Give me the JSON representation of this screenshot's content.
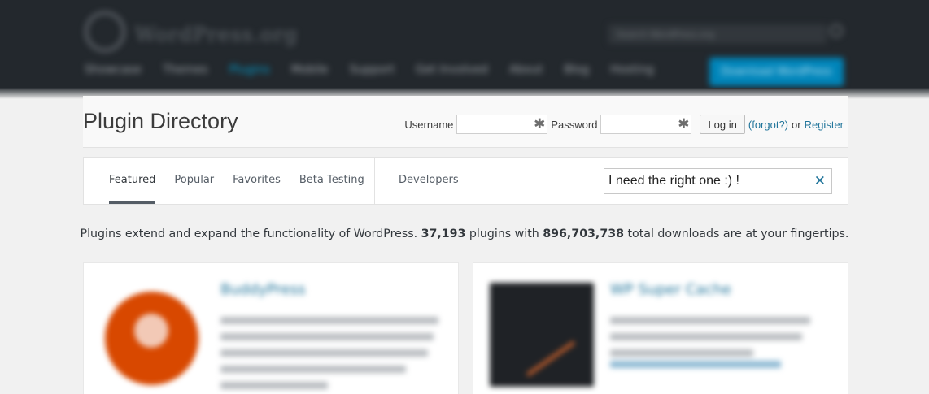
{
  "header": {
    "title": "Plugin Directory",
    "username_label": "Username",
    "password_label": "Password",
    "login_button": "Log in",
    "forgot_link": "(forgot?)",
    "or_text": "or",
    "register_link": "Register"
  },
  "tabs": [
    {
      "label": "Featured",
      "active": true
    },
    {
      "label": "Popular",
      "active": false
    },
    {
      "label": "Favorites",
      "active": false
    },
    {
      "label": "Beta Testing",
      "active": false
    }
  ],
  "developers_tab": "Developers",
  "search": {
    "value": "I need the right one :) !",
    "clear_icon": "close-icon"
  },
  "intro": {
    "prefix": "Plugins extend and expand the functionality of WordPress.",
    "plugin_count": "37,193",
    "middle": "plugins with",
    "download_count": "896,703,738",
    "suffix": "total downloads are at your fingertips."
  },
  "colors": {
    "topbar": "#23282d",
    "link": "#21759b",
    "accent_button": "#0085ba",
    "buddypress_orange": "#d84800"
  }
}
